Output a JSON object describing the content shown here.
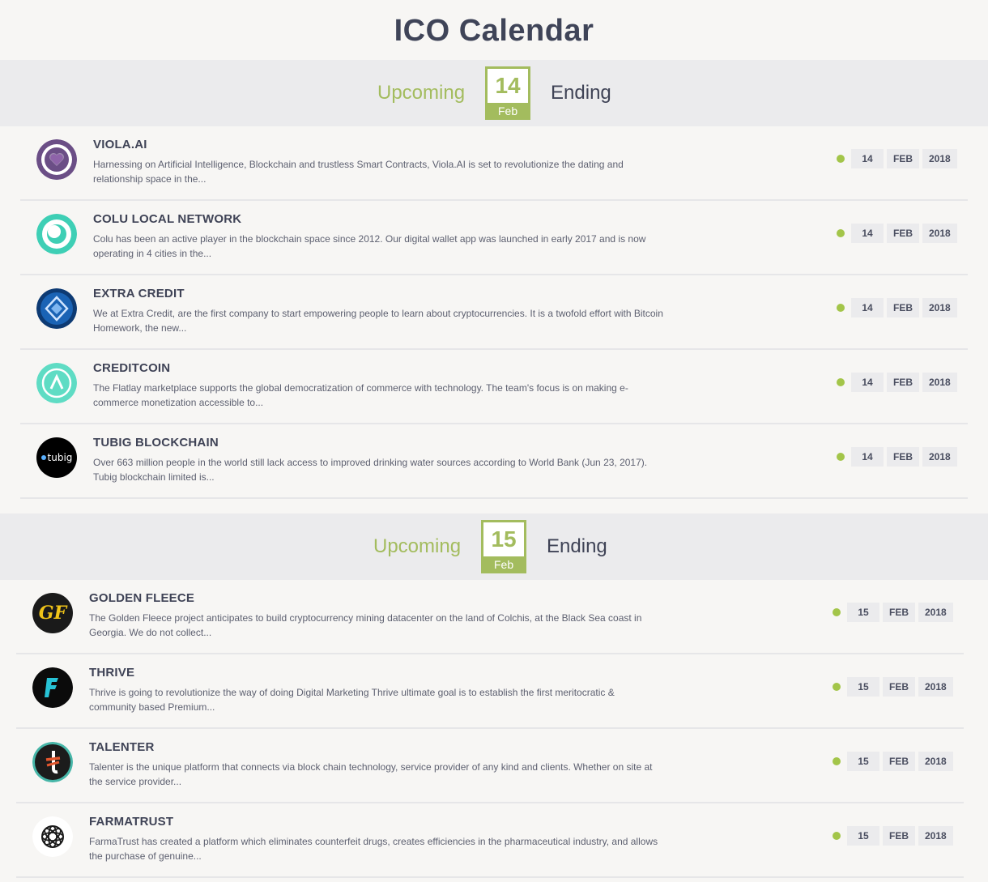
{
  "page_title": "ICO Calendar",
  "days": [
    {
      "upcoming_label": "Upcoming",
      "ending_label": "Ending",
      "day": "14",
      "month": "Feb",
      "items": [
        {
          "name": "VIOLA.AI",
          "description": "Harnessing on Artificial Intelligence, Blockchain and trustless Smart Contracts, Viola.AI is set to revolutionize the dating and relationship space in the...",
          "day": "14",
          "month": "FEB",
          "year": "2018",
          "logo": "heart-logo-icon"
        },
        {
          "name": "COLU LOCAL NETWORK",
          "description": "Colu has been an active player in the blockchain space since 2012. Our digital wallet app was launched in early 2017 and is now operating in 4 cities in the...",
          "day": "14",
          "month": "FEB",
          "year": "2018",
          "logo": "colu-logo-icon"
        },
        {
          "name": "EXTRA CREDIT",
          "description": "We at Extra Credit, are the first company to start empowering people to learn about cryptocurrencies. It is a twofold effort with Bitcoin Homework, the new...",
          "day": "14",
          "month": "FEB",
          "year": "2018",
          "logo": "extra-credit-logo-icon"
        },
        {
          "name": "CREDITCOIN",
          "description": "The Flatlay marketplace supports the global democratization of commerce with technology. The team's focus is on making e-commerce monetization accessible to...",
          "day": "14",
          "month": "FEB",
          "year": "2018",
          "logo": "creditcoin-logo-icon"
        },
        {
          "name": "TUBIG BLOCKCHAIN",
          "description": "Over 663 million people in the world still lack access to improved drinking water sources according to World Bank (Jun 23, 2017). Tubig blockchain limited is...",
          "day": "14",
          "month": "FEB",
          "year": "2018",
          "logo": "tubig-logo-icon",
          "logo_text": "tubig"
        }
      ]
    },
    {
      "upcoming_label": "Upcoming",
      "ending_label": "Ending",
      "day": "15",
      "month": "Feb",
      "items": [
        {
          "name": "GOLDEN FLEECE",
          "description": "The Golden Fleece project anticipates to build cryptocurrency mining datacenter on the land of Colchis, at the Black Sea coast in Georgia. We do not collect...",
          "day": "15",
          "month": "FEB",
          "year": "2018",
          "logo": "golden-fleece-logo-icon",
          "logo_text": "GF"
        },
        {
          "name": "THRIVE",
          "description": "Thrive is going to revolutionize the way of doing Digital Marketing Thrive ultimate goal is to establish the first meritocratic & community based Premium...",
          "day": "15",
          "month": "FEB",
          "year": "2018",
          "logo": "thrive-logo-icon"
        },
        {
          "name": "TALENTER",
          "description": "Talenter is the unique platform that connects via block chain technology, service provider of any kind and clients. Whether on site at the service provider...",
          "day": "15",
          "month": "FEB",
          "year": "2018",
          "logo": "talenter-logo-icon"
        },
        {
          "name": "FARMATRUST",
          "description": "FarmaTrust has created a platform which eliminates counterfeit drugs, creates efficiencies in the pharmaceutical industry, and allows the purchase of genuine...",
          "day": "15",
          "month": "FEB",
          "year": "2018",
          "logo": "farmatrust-logo-icon"
        }
      ]
    }
  ]
}
